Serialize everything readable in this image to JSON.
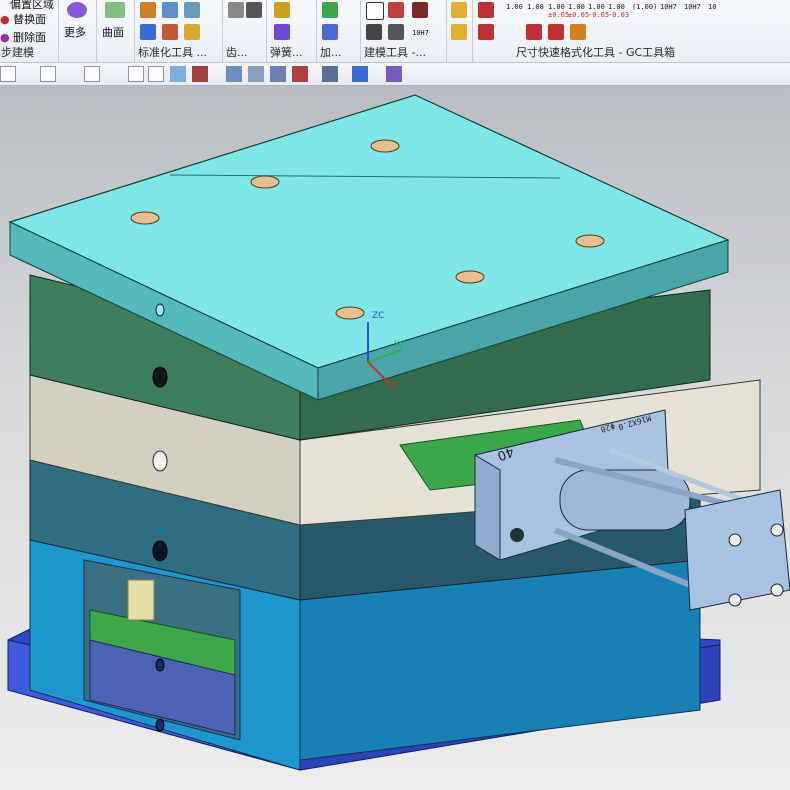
{
  "ribbon": {
    "sync_group": {
      "items": [
        "偏置区域",
        "替换面",
        "删除面"
      ],
      "label": "同步建模"
    },
    "more_label": "更多",
    "surface_label": "曲面",
    "groups": {
      "standard": "标准化工具 ...",
      "gear": "齿...",
      "spring": "弹簧...",
      "add": "加...",
      "mold": "建模工具 -...",
      "dim": "尺寸快速格式化工具 - GC工具箱"
    },
    "dim_tiles": {
      "row1": [
        "1.00",
        "1.00",
        "1.00",
        "1.00",
        "1.00",
        "1.00",
        "(1.00)",
        "10H7",
        "10H7",
        "10"
      ],
      "row2": [
        "",
        "",
        "±0.05",
        "±0.05",
        "-0.05",
        "-0.03",
        "",
        "",
        "",
        ""
      ],
      "bottom": [
        "10H7"
      ]
    }
  },
  "viewport": {
    "axes": {
      "z": "ZC",
      "y": "YC",
      "x": "XC"
    },
    "cylinder_labels": {
      "size": "40",
      "thread": "M16X2.0",
      "bore": "Φ20"
    }
  },
  "colors": {
    "top_plate": "#7fe6e6",
    "green_plate": "#3c7b5b",
    "stripper_plate": "#cfcdbd",
    "teal_plate": "#2f6575",
    "blue_block": "#1e8bc2",
    "base_plate": "#4056d2",
    "cylinder": "#a9c1e0"
  }
}
